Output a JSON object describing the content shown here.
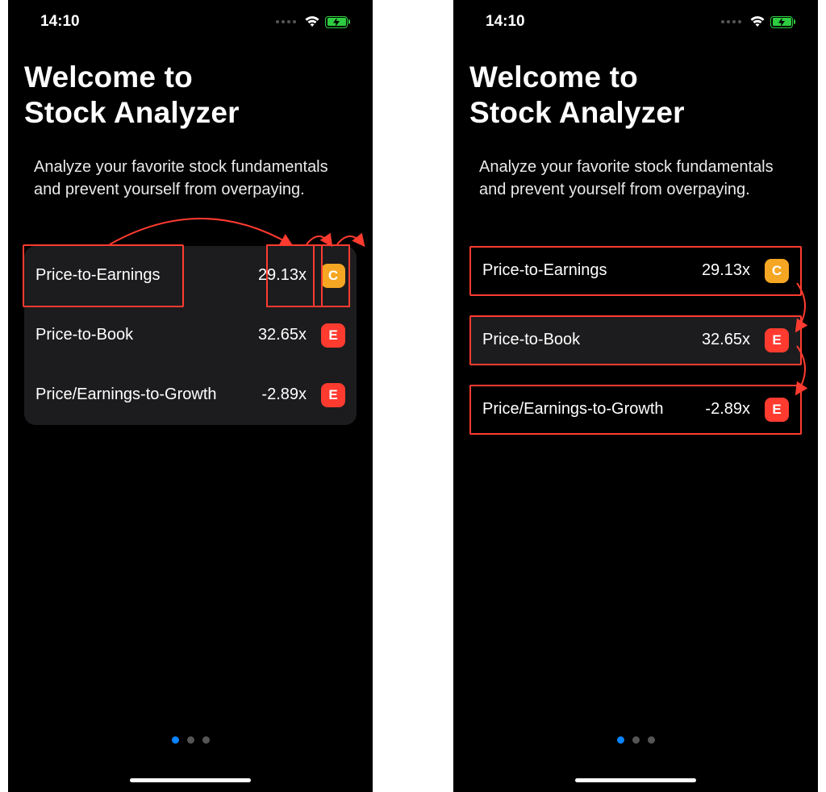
{
  "status": {
    "time": "14:10"
  },
  "heading": {
    "line1": "Welcome to",
    "line2": "Stock Analyzer"
  },
  "subtitle": "Analyze your favorite stock fundamentals and prevent yourself from overpaying.",
  "metrics": [
    {
      "label": "Price-to-Earnings",
      "value": "29.13x",
      "grade": "C",
      "grade_color": "#f5a623"
    },
    {
      "label": "Price-to-Book",
      "value": "32.65x",
      "grade": "E",
      "grade_color": "#ff3b30"
    },
    {
      "label": "Price/Earnings-to-Growth",
      "value": "-2.89x",
      "grade": "E",
      "grade_color": "#ff3b30"
    }
  ],
  "pagination": {
    "total": 3,
    "current": 0
  },
  "annotation_color": "#ff3b30"
}
